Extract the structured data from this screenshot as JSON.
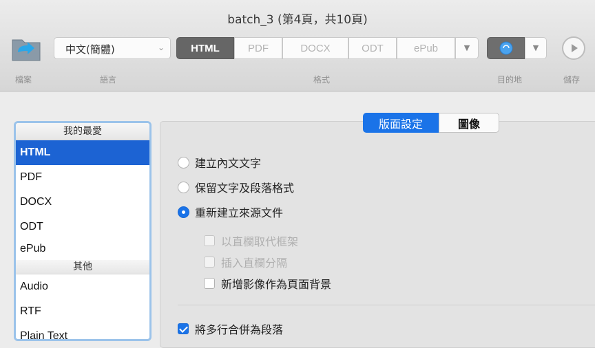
{
  "window": {
    "title": "batch_3 (第4頁，共10頁)"
  },
  "toolbar": {
    "file_label": "檔案",
    "language": {
      "value": "中文(簡體)",
      "label": "語言"
    },
    "formats": [
      "HTML",
      "PDF",
      "DOCX",
      "ODT",
      "ePub"
    ],
    "active_format": "HTML",
    "format_label": "格式",
    "destination_label": "目的地",
    "save_label": "儲存"
  },
  "sidebar": {
    "favorites_header": "我的最愛",
    "favorites": [
      "HTML",
      "PDF",
      "DOCX",
      "ODT",
      "ePub"
    ],
    "other_header": "其他",
    "others": [
      "Audio",
      "RTF",
      "Plain Text"
    ]
  },
  "panel": {
    "tabs": [
      "版面設定",
      "圖像"
    ],
    "active_tab": "版面設定",
    "radio_options": [
      {
        "label": "建立內文文字",
        "selected": false
      },
      {
        "label": "保留文字及段落格式",
        "selected": false
      },
      {
        "label": "重新建立來源文件",
        "selected": true
      }
    ],
    "sub_options": [
      {
        "label": "以直欄取代框架",
        "checked": false,
        "enabled": false
      },
      {
        "label": "插入直欄分隔",
        "checked": false,
        "enabled": false
      },
      {
        "label": "新增影像作為頁面背景",
        "checked": false,
        "enabled": true
      }
    ],
    "merge_option": {
      "label": "將多行合併為段落",
      "checked": true
    }
  },
  "colors": {
    "accent": "#1a73e8",
    "selection": "#1c63d3",
    "sidebar_border": "#9bc3ea"
  },
  "icons": {
    "file": "folder-arrow-icon",
    "destination": "finder-icon",
    "save": "play-icon"
  }
}
